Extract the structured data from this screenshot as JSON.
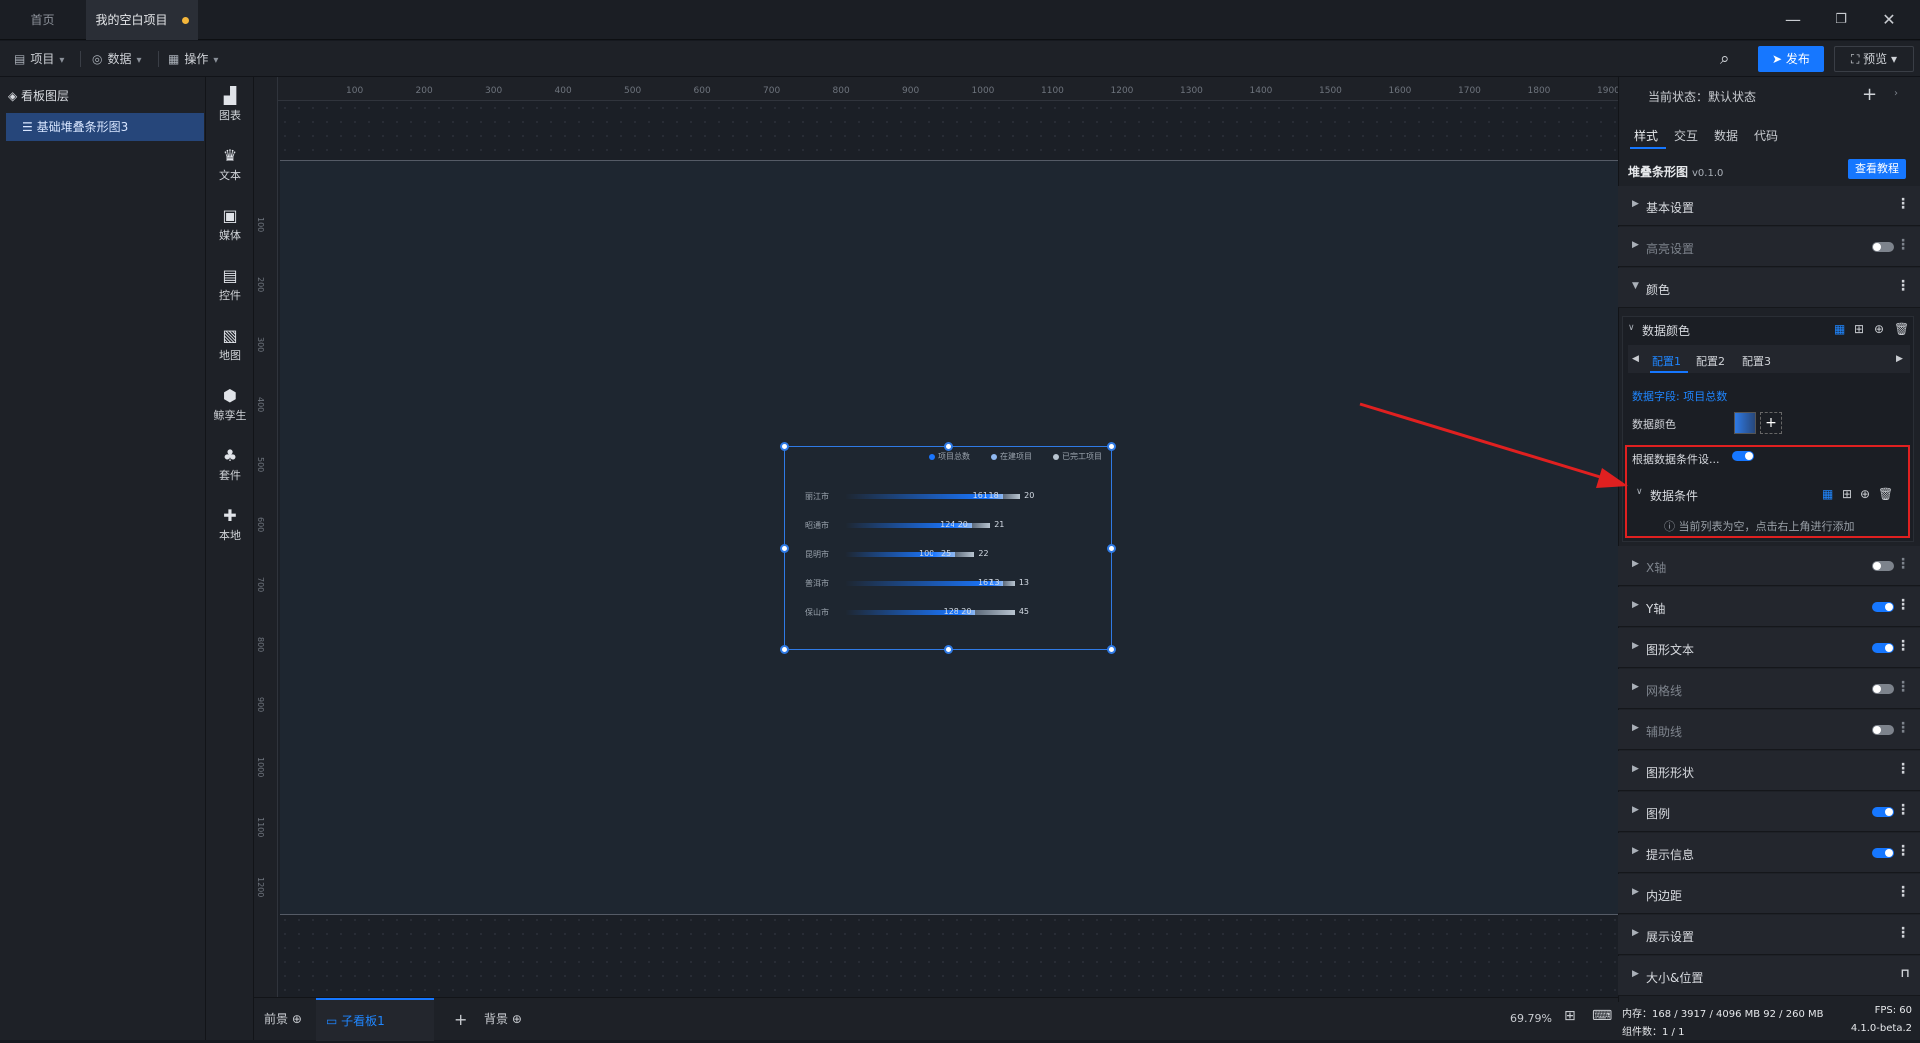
{
  "tabs": {
    "home": "首页",
    "project": "我的空白项目"
  },
  "menu": {
    "project": "项目",
    "data": "数据",
    "ops": "操作"
  },
  "toolbar": {
    "publish": "发布",
    "preview": "预览"
  },
  "layers": {
    "title": "看板图层",
    "item": "基础堆叠条形图3"
  },
  "tools": [
    "图表",
    "文本",
    "媒体",
    "控件",
    "地图",
    "鲸孪生",
    "套件",
    "本地"
  ],
  "ruler": {
    "h": [
      "100",
      "200",
      "300",
      "400",
      "500",
      "600",
      "700",
      "800",
      "900",
      "1000",
      "1100",
      "1200",
      "1300",
      "1400",
      "1500",
      "1600",
      "1700",
      "1800",
      "1900"
    ],
    "v": [
      "100",
      "200",
      "300",
      "400",
      "500",
      "600",
      "700",
      "800",
      "900",
      "1000",
      "1100",
      "1200"
    ]
  },
  "chart_data": {
    "type": "bar",
    "orientation": "horizontal",
    "stacked": true,
    "categories": [
      "丽江市",
      "昭通市",
      "昆明市",
      "普洱市",
      "保山市"
    ],
    "series": [
      {
        "name": "项目总数",
        "values": [
          161,
          124,
          100,
          167,
          128
        ],
        "color": "#1a76ff"
      },
      {
        "name": "在建项目",
        "values": [
          18,
          20,
          25,
          13,
          20
        ],
        "color": "#8fb8f0"
      },
      {
        "name": "已完工项目",
        "values": [
          20,
          21,
          22,
          13,
          45
        ],
        "color": "#b8c4d0"
      }
    ]
  },
  "chart_labels": {
    "row0": {
      "a": "161",
      "b": "18",
      "c": "20"
    },
    "row1": {
      "a": "124",
      "b": "20",
      "c": "21"
    },
    "row2": {
      "a": "100",
      "b": "25",
      "c": "22"
    },
    "row3": {
      "a": "167",
      "b": "13",
      "c": "13"
    },
    "row4": {
      "a": "128",
      "b": "20",
      "c": "45"
    }
  },
  "bottom": {
    "front": "前景",
    "sub": "子看板1",
    "back": "背景",
    "zoom": "69.79%"
  },
  "right": {
    "state": "当前状态：默认状态",
    "tabs": [
      "样式",
      "交互",
      "数据",
      "代码"
    ],
    "comp_title": "堆叠条形图",
    "comp_version": "v0.1.0",
    "tutorial": "查看教程",
    "sections": [
      "基本设置",
      "高亮设置",
      "颜色",
      "X轴",
      "Y轴",
      "图形文本",
      "网格线",
      "辅助线",
      "图形形状",
      "图例",
      "提示信息",
      "内边距",
      "展示设置",
      "大小&位置"
    ],
    "color": {
      "sub": "数据颜色",
      "cfgs": [
        "配置1",
        "配置2",
        "配置3"
      ],
      "field": "数据字段: 项目总数",
      "data_color": "数据颜色",
      "cond_toggle": "根据数据条件设...",
      "cond": "数据条件",
      "empty": "当前列表为空，点击右上角进行添加"
    }
  },
  "status": {
    "mem": "内存：168 / 3917 / 4096 MB  92 / 260 MB",
    "fps": "FPS: 60",
    "count": "组件数：1 / 1",
    "ver": "4.1.0-beta.2"
  },
  "colors": {
    "accent": "#1677ff",
    "highlight": "#e02020"
  }
}
